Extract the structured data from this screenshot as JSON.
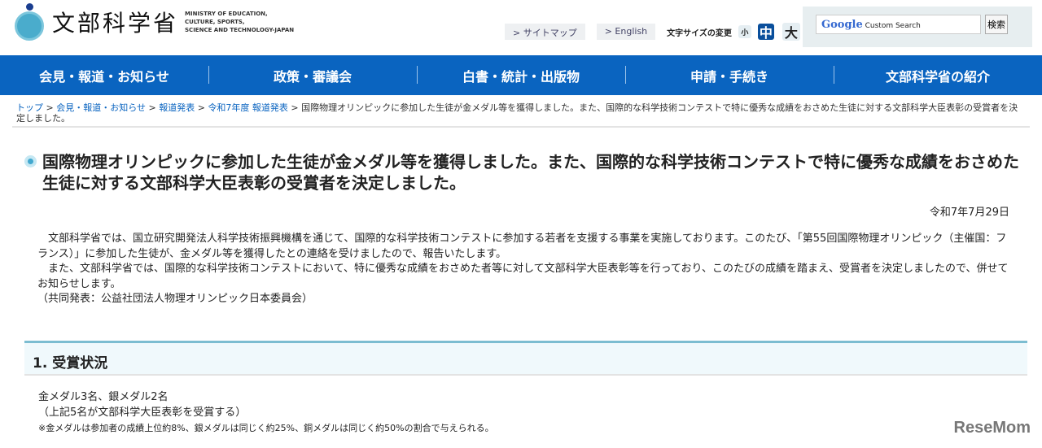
{
  "header": {
    "logo_jp": "文部科学省",
    "logo_en": [
      "MINISTRY OF EDUCATION,",
      "CULTURE, SPORTS,",
      "SCIENCE AND TECHNOLOGY-JAPAN"
    ],
    "sitemap": "> サイトマップ",
    "english": "> English",
    "font_size_label": "文字サイズの変更",
    "font_small": "小",
    "font_medium": "中",
    "font_large": "大",
    "search_brand": "Google",
    "search_placeholder": "Custom Search",
    "search_button": "検索"
  },
  "nav": [
    "会見・報道・お知らせ",
    "政策・審議会",
    "白書・統計・出版物",
    "申請・手続き",
    "文部科学省の紹介"
  ],
  "breadcrumb": {
    "links": [
      "トップ",
      "会見・報道・お知らせ",
      "報道発表",
      "令和7年度 報道発表"
    ],
    "current": "国際物理オリンピックに参加した生徒が金メダル等を獲得しました。また、国際的な科学技術コンテストで特に優秀な成績をおさめた生徒に対する文部科学大臣表彰の受賞者を決定しました。"
  },
  "title": "国際物理オリンピックに参加した生徒が金メダル等を獲得しました。また、国際的な科学技術コンテストで特に優秀な成績をおさめた生徒に対する文部科学大臣表彰の受賞者を決定しました。",
  "date": "令和7年7月29日",
  "paragraphs": [
    "　文部科学省では、国立研究開発法人科学技術振興機構を通じて、国際的な科学技術コンテストに参加する若者を支援する事業を実施しております。このたび、「第55回国際物理オリンピック（主催国：フランス）」に参加した生徒が、金メダル等を獲得したとの連絡を受けましたので、報告いたします。",
    "　また、文部科学省では、国際的な科学技術コンテストにおいて、特に優秀な成績をおさめた者等に対して文部科学大臣表彰等を行っており、このたびの成績を踏まえ、受賞者を決定しましたので、併せてお知らせします。",
    "（共同発表：公益社団法人物理オリンピック日本委員会）"
  ],
  "section": {
    "heading": "1. 受賞状況",
    "lines": [
      "金メダル3名、銀メダル2名",
      "（上記5名が文部科学大臣表彰を受賞する）"
    ],
    "note": "※金メダルは参加者の成績上位約8%、銀メダルは同じく約25%、銅メダルは同じく約50%の割合で与えられる。"
  },
  "watermark": "ReseMom"
}
